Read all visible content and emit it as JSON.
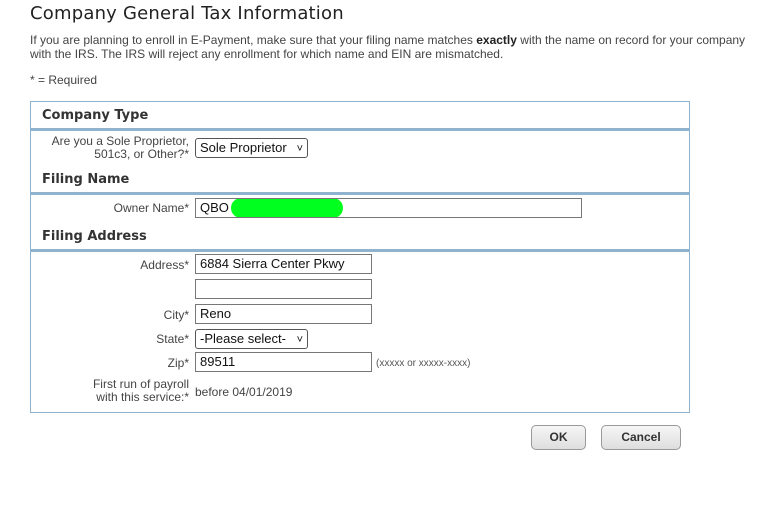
{
  "page": {
    "title": "Company General Tax Information",
    "intro_before": "If you are planning to enroll in E-Payment, make sure that your filing name matches ",
    "intro_bold": "exactly",
    "intro_after": " with the name on record for your company with the IRS. The IRS will reject any enrollment for which name and EIN are mismatched.",
    "required_note": "* = Required"
  },
  "company_type": {
    "heading": "Company Type",
    "label_line1": "Are you a Sole Proprietor,",
    "label_line2": "501c3, or Other?*",
    "selected": "Sole Proprietor"
  },
  "filing_name": {
    "heading": "Filing Name",
    "owner_label": "Owner Name*",
    "owner_value": "QBO"
  },
  "filing_address": {
    "heading": "Filing Address",
    "address_label": "Address*",
    "address_line1": "6884 Sierra Center Pkwy",
    "address_line2": "",
    "city_label": "City*",
    "city_value": "Reno",
    "state_label": "State*",
    "state_selected": "-Please select-",
    "zip_label": "Zip*",
    "zip_value": "89511",
    "zip_hint": "(xxxxx or xxxxx-xxxx)",
    "payroll_label_line1": "First run of payroll",
    "payroll_label_line2": "with this service:*",
    "payroll_value": "before 04/01/2019"
  },
  "buttons": {
    "ok": "OK",
    "cancel": "Cancel"
  }
}
